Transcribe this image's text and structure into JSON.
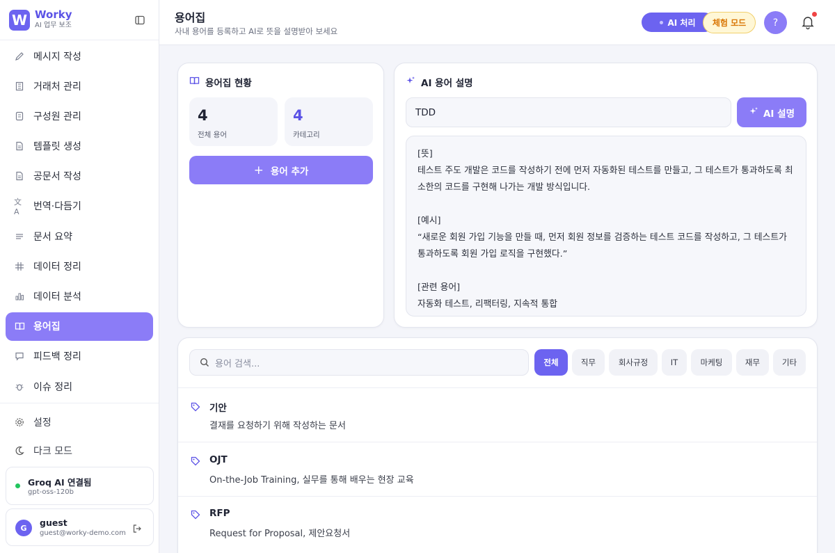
{
  "brand": {
    "logo_letter": "W",
    "name": "Worky",
    "subtitle": "AI 업무 보조"
  },
  "sidebar": {
    "items": [
      {
        "label": "메시지 작성",
        "icon": "pencil-icon"
      },
      {
        "label": "거래처 관리",
        "icon": "building-icon"
      },
      {
        "label": "구성원 관리",
        "icon": "id-card-icon"
      },
      {
        "label": "템플릿 생성",
        "icon": "document-icon"
      },
      {
        "label": "공문서 작성",
        "icon": "document-icon"
      },
      {
        "label": "번역·다듬기",
        "icon": "translate-icon"
      },
      {
        "label": "문서 요약",
        "icon": "lines-icon"
      },
      {
        "label": "데이터 정리",
        "icon": "grid-icon"
      },
      {
        "label": "데이터 분석",
        "icon": "chart-icon"
      },
      {
        "label": "용어집",
        "icon": "book-icon",
        "active": true
      },
      {
        "label": "피드백 정리",
        "icon": "chat-icon"
      },
      {
        "label": "이슈 정리",
        "icon": "bug-icon"
      }
    ],
    "settings_label": "설정",
    "dark_mode_label": "다크 모드",
    "ai_status": {
      "title": "Groq AI 연결됨",
      "model": "gpt-oss-120b"
    },
    "user": {
      "initial": "G",
      "name": "guest",
      "email": "guest@worky-demo.com"
    }
  },
  "header": {
    "title": "용어집",
    "subtitle": "사내 용어를 등록하고 AI로 뜻을 설명받아 보세요",
    "ai_badge": "AI 처리",
    "trial_badge": "체험 모드",
    "help": "?"
  },
  "summary": {
    "title": "용어집 현황",
    "stats": [
      {
        "value": "4",
        "label": "전체 용어"
      },
      {
        "value": "4",
        "label": "카테고리"
      }
    ],
    "add_button": "용어 추가"
  },
  "ai_explain": {
    "title": "AI 용어 설명",
    "input_value": "TDD",
    "button": "AI 설명",
    "result": [
      {
        "heading": "[뜻]",
        "text": "테스트 주도 개발은 코드를 작성하기 전에 먼저 자동화된 테스트를 만들고, 그 테스트가 통과하도록 최소한의 코드를 구현해 나가는 개발 방식입니다."
      },
      {
        "heading": "[예시]",
        "text": "“새로운 회원 가입 기능을 만들 때, 먼저 회원 정보를 검증하는 테스트 코드를 작성하고, 그 테스트가 통과하도록 회원 가입 로직을 구현했다.”"
      },
      {
        "heading": "[관련 용어]",
        "text": "자동화 테스트, 리팩터링, 지속적 통합"
      }
    ]
  },
  "glossary": {
    "search_placeholder": "용어 검색...",
    "filters": [
      "전체",
      "직무",
      "회사규정",
      "IT",
      "마케팅",
      "재무",
      "기타"
    ],
    "terms": [
      {
        "name": "기안",
        "desc": "결재를 요청하기 위해 작성하는 문서"
      },
      {
        "name": "OJT",
        "desc": "On-the-Job Training, 실무를 통해 배우는 현장 교육"
      },
      {
        "name": "RFP",
        "desc": "Request for Proposal, 제안요청서"
      }
    ]
  },
  "colors": {
    "accent": "#6c63f0",
    "accent_light": "#8b7cf7",
    "trial": "#d97706",
    "online": "#22c55e",
    "alert": "#ef4444"
  }
}
